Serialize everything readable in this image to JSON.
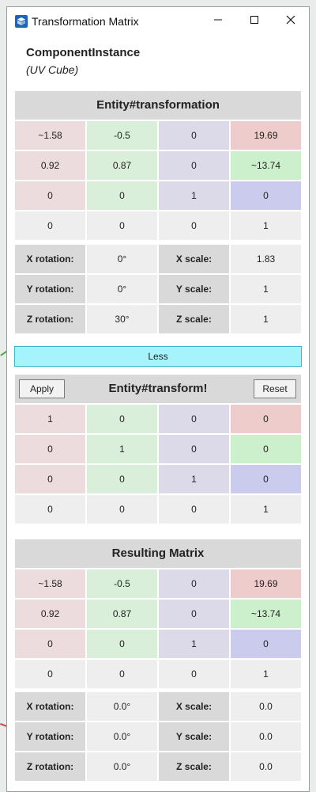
{
  "window": {
    "title": "Transformation Matrix"
  },
  "component": {
    "name": "ComponentInstance",
    "subtitle": "(UV Cube)"
  },
  "transformation": {
    "header": "Entity#transformation",
    "matrix": [
      [
        "~1.58",
        "-0.5",
        "0",
        "19.69"
      ],
      [
        "0.92",
        "0.87",
        "0",
        "~13.74"
      ],
      [
        "0",
        "0",
        "1",
        "0"
      ],
      [
        "0",
        "0",
        "0",
        "1"
      ]
    ],
    "props": [
      {
        "rot_label": "X rotation:",
        "rot_value": "0°",
        "scale_label": "X scale:",
        "scale_value": "1.83"
      },
      {
        "rot_label": "Y rotation:",
        "rot_value": "0°",
        "scale_label": "Y scale:",
        "scale_value": "1"
      },
      {
        "rot_label": "Z rotation:",
        "rot_value": "30°",
        "scale_label": "Z scale:",
        "scale_value": "1"
      }
    ]
  },
  "less_label": "Less",
  "transform": {
    "header": "Entity#transform!",
    "apply_label": "Apply",
    "reset_label": "Reset",
    "matrix": [
      [
        "1",
        "0",
        "0",
        "0"
      ],
      [
        "0",
        "1",
        "0",
        "0"
      ],
      [
        "0",
        "0",
        "1",
        "0"
      ],
      [
        "0",
        "0",
        "0",
        "1"
      ]
    ]
  },
  "result": {
    "header": "Resulting Matrix",
    "matrix": [
      [
        "~1.58",
        "-0.5",
        "0",
        "19.69"
      ],
      [
        "0.92",
        "0.87",
        "0",
        "~13.74"
      ],
      [
        "0",
        "0",
        "1",
        "0"
      ],
      [
        "0",
        "0",
        "0",
        "1"
      ]
    ],
    "props": [
      {
        "rot_label": "X rotation:",
        "rot_value": "0.0°",
        "scale_label": "X scale:",
        "scale_value": "0.0"
      },
      {
        "rot_label": "Y rotation:",
        "rot_value": "0.0°",
        "scale_label": "Y scale:",
        "scale_value": "0.0"
      },
      {
        "rot_label": "Z rotation:",
        "rot_value": "0.0°",
        "scale_label": "Z scale:",
        "scale_value": "0.0"
      }
    ]
  }
}
